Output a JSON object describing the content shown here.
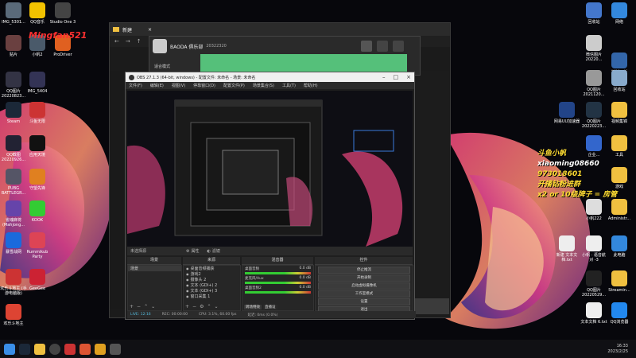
{
  "desktop": {
    "left_icons": [
      {
        "label": "IMG_5301...",
        "color": "#5a6a7a"
      },
      {
        "label": "QQ音乐",
        "color": "#f2c200"
      },
      {
        "label": "Studio One 3",
        "color": "#444"
      },
      {
        "label": "贴片",
        "color": "#6a4040"
      },
      {
        "label": "小帆2",
        "color": "#4a5a6a"
      },
      {
        "label": "ProDriver",
        "color": "#e06020"
      },
      {
        "label": "QQ图片 20220823...",
        "color": "#334"
      },
      {
        "label": "IMG_5404",
        "color": "#335"
      },
      {
        "label": "Steam",
        "color": "#1b2838"
      },
      {
        "label": "斗鱼无限",
        "color": "#cc3333"
      },
      {
        "label": "QQ截图 20220926...",
        "color": "#223"
      },
      {
        "label": "应用天境",
        "color": "#111"
      },
      {
        "label": "PUBG BATTLEGR...",
        "color": "#556"
      },
      {
        "label": "守望先锋",
        "color": "#e08020"
      },
      {
        "label": "雀魂麻将 (Mahjong...",
        "color": "#6644aa"
      },
      {
        "label": "KOOK",
        "color": "#33cc33"
      },
      {
        "label": "暴雪战网",
        "color": "#1a6adc"
      },
      {
        "label": "Rummikub Party",
        "color": "#dd4455"
      },
      {
        "label": "欢乐斗地主 (手游电脑版)",
        "color": "#cc3333"
      },
      {
        "label": "GeeGee",
        "color": "#cc2233"
      },
      {
        "label": "欢乐斗地主",
        "color": "#dd4433"
      }
    ],
    "right_icons": [
      {
        "label": "回收站",
        "color": "#4477cc"
      },
      {
        "label": "网络",
        "color": "#3388dd"
      },
      {
        "label": "微信图片 20220...",
        "color": "#ccc"
      },
      {
        "label": "QQ图片 2021120...",
        "color": "#999"
      },
      {
        "label": "控制面板",
        "color": "#3366aa"
      },
      {
        "label": "QQ图片 20220223...",
        "color": "#234"
      },
      {
        "label": "回收站",
        "color": "#88aacc"
      },
      {
        "label": "网易UU加速器",
        "color": "#224488"
      },
      {
        "label": "视频集锦",
        "color": "#f0c040"
      },
      {
        "label": "企业...",
        "color": "#3366cc"
      },
      {
        "label": "工具",
        "color": "#f0c040"
      },
      {
        "label": "游戏",
        "color": "#f0c040"
      },
      {
        "label": "小帆222",
        "color": "#ddd"
      },
      {
        "label": "Administr...",
        "color": "#f0c040"
      },
      {
        "label": "新建 文本文档.txt",
        "color": "#eee"
      },
      {
        "label": "小帆 · 语音航 对 -3",
        "color": "#eee"
      },
      {
        "label": "此电脑",
        "color": "#3388dd"
      },
      {
        "label": "QQ图片 20220529...",
        "color": "#222"
      },
      {
        "label": "Streamin...",
        "color": "#f0c040"
      },
      {
        "label": "文本文档 6.txt",
        "color": "#eee"
      },
      {
        "label": "QQ浏览器",
        "color": "#2288ee"
      }
    ],
    "watermark": "Mingfan521",
    "streamer_info": [
      {
        "text": "斗鱼小帆",
        "color": "#ffdd33"
      },
      {
        "text": "xiaoming08660",
        "color": "#ffffff"
      },
      {
        "text": "973018601",
        "color": "#ffdd33"
      },
      {
        "text": "开播钻粉进群",
        "color": "#ffdd33"
      },
      {
        "text": "x2 or 10级牌子 = 房管",
        "color": "#ffdd33"
      }
    ]
  },
  "explorer": {
    "title": "新建",
    "close": "×"
  },
  "wechat": {
    "name": "BAODA 俱乐部",
    "id": "20322320",
    "tab": "适合模式"
  },
  "obs": {
    "title": "OBS 27.1.3 (64-bit, windows) - 配置文件: 未命名 - 场景: 未命名",
    "menu": [
      "文件(F)",
      "编辑(E)",
      "视图(V)",
      "停靠窗口(D)",
      "配置文件(P)",
      "场景集合(S)",
      "工具(T)",
      "帮助(H)"
    ],
    "no_source": "未选择源",
    "properties": "属性",
    "filters": "滤镜",
    "docks": {
      "scenes": "场景",
      "sources": "来源",
      "mixer": "混音器",
      "controls": "控件"
    },
    "scene_items": [
      "场景"
    ],
    "source_items": [
      "桌面音频捕获",
      "游戏2",
      "摄像头 2",
      "文本 (GDI+) 2",
      "文本 (GDI+) 3",
      "窗口采集 1"
    ],
    "mixer_tracks": [
      {
        "name": "桌面音频",
        "db": "0.0 dB"
      },
      {
        "name": "麦克风/Aux",
        "db": "0.0 dB"
      },
      {
        "name": "桌面音频2",
        "db": "0.0 dB"
      }
    ],
    "mixer_tabs": [
      "转场特效",
      "直播设"
    ],
    "controls": [
      "停止推流",
      "开始录制",
      "启动虚拟摄像机",
      "工作室模式",
      "设置",
      "退出"
    ],
    "status": {
      "live": "LIVE: 12:16",
      "rec": "REC: 00:00:00",
      "cpu": "CPU: 3.1%, 60.00 fps",
      "kbps": "延迟: 0ms (0.0%)"
    }
  },
  "taskbar": {
    "time": "16:33",
    "date": "2023/2/25"
  }
}
